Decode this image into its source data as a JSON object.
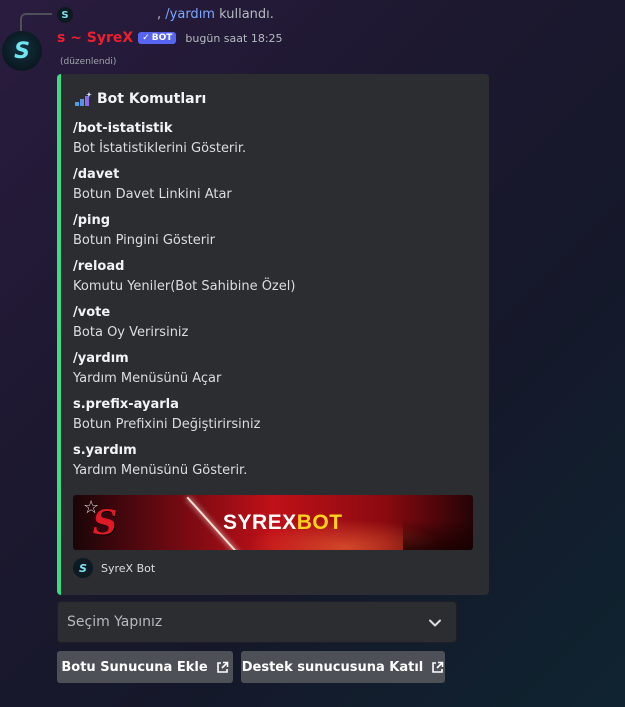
{
  "reply": {
    "avatar_letter": "S",
    "separator": ",",
    "command": "/yardım",
    "suffix": "kullandı."
  },
  "message": {
    "avatar_letter": "S",
    "username": "s ~ SyreX",
    "bot_tag": "BOT",
    "bot_check": "✓",
    "timestamp": "bugün saat 18:25",
    "edited": "(düzenlendi)"
  },
  "embed": {
    "accent_color": "#3ddc84",
    "title_icon": "sparkle-stairs-icon",
    "title": "Bot Komutları",
    "fields": [
      {
        "name": "/bot-istatistik",
        "value": "Bot İstatistiklerini Gösterir."
      },
      {
        "name": "/davet",
        "value": "Botun Davet Linkini Atar"
      },
      {
        "name": "/ping",
        "value": "Botun Pingini Gösterir"
      },
      {
        "name": "/reload",
        "value": "Komutu Yeniler(Bot Sahibine Özel)"
      },
      {
        "name": "/vote",
        "value": "Bota Oy Verirsiniz"
      },
      {
        "name": "/yardım",
        "value": "Yardım Menüsünü Açar"
      },
      {
        "name": "s.prefix-ayarla",
        "value": "Botun Prefixini Değiştirirsiniz"
      },
      {
        "name": "s.yardım",
        "value": "Yardım Menüsünü Gösterir."
      }
    ],
    "banner": {
      "logo_letter": "S",
      "text_main": "SYREX",
      "text_accent": "BOT"
    },
    "footer": {
      "icon_letter": "S",
      "text": "SyreX Bot"
    }
  },
  "select": {
    "placeholder": "Seçim Yapınız"
  },
  "buttons": {
    "add_label": "Botu Sunucuna Ekle",
    "support_label": "Destek sunucusuna Katıl"
  },
  "colors": {
    "username": "#ee1f2f",
    "bot_tag": "#5865f2",
    "command": "#7aa7ff",
    "button": "#4e5058"
  }
}
